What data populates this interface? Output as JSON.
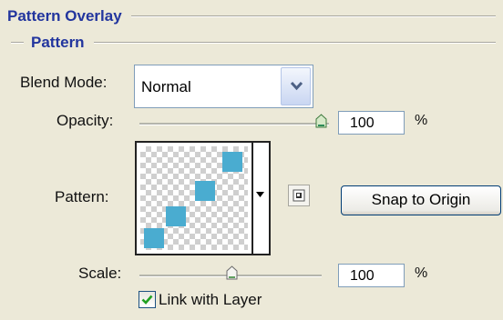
{
  "section_title": "Pattern Overlay",
  "group_title": "Pattern",
  "blend_mode": {
    "label": "Blend Mode:",
    "value": "Normal"
  },
  "opacity": {
    "label": "Opacity:",
    "value": "100",
    "unit": "%",
    "slider_fraction": 1.0
  },
  "pattern": {
    "label": "Pattern:",
    "swatch_color": "#4AACD0"
  },
  "snap_button": {
    "label": "Snap to Origin"
  },
  "scale": {
    "label": "Scale:",
    "value": "100",
    "unit": "%",
    "slider_fraction": 0.5
  },
  "link_with_layer": {
    "label": "Link with Layer",
    "checked": true
  }
}
